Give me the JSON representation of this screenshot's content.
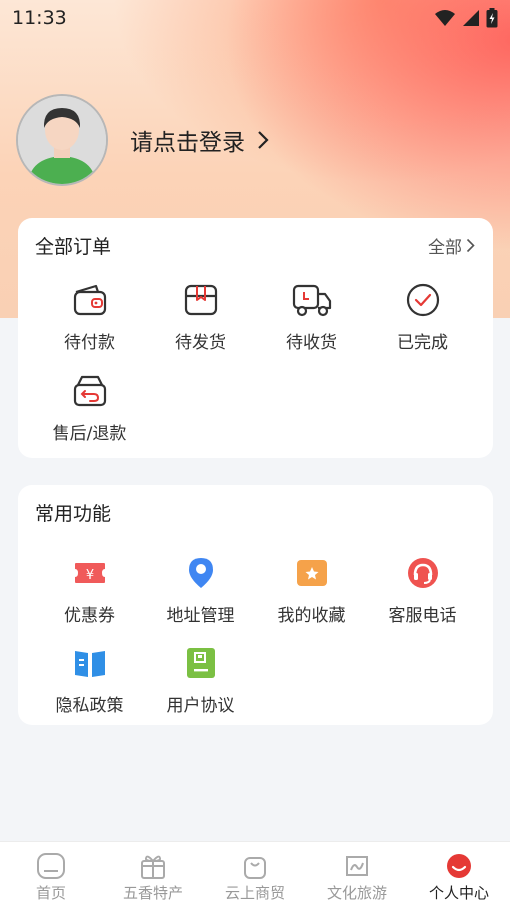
{
  "status": {
    "time": "11:33"
  },
  "profile": {
    "login_text": "请点击登录"
  },
  "orders": {
    "title": "全部订单",
    "more": "全部",
    "items": [
      {
        "label": "待付款",
        "icon": "wallet-icon"
      },
      {
        "label": "待发货",
        "icon": "package-icon"
      },
      {
        "label": "待收货",
        "icon": "truck-icon"
      },
      {
        "label": "已完成",
        "icon": "check-circle-icon"
      },
      {
        "label": "售后/退款",
        "icon": "return-box-icon"
      }
    ]
  },
  "functions": {
    "title": "常用功能",
    "items": [
      {
        "label": "优惠券",
        "icon": "coupon-icon",
        "color": "#f05a5a"
      },
      {
        "label": "地址管理",
        "icon": "location-pin-icon",
        "color": "#3f86f2"
      },
      {
        "label": "我的收藏",
        "icon": "favorite-icon",
        "color": "#f5a24a"
      },
      {
        "label": "客服电话",
        "icon": "headset-icon",
        "color": "#ef5350"
      },
      {
        "label": "隐私政策",
        "icon": "book-icon",
        "color": "#2f8fe6"
      },
      {
        "label": "用户协议",
        "icon": "agreement-icon",
        "color": "#7bc043"
      }
    ]
  },
  "tabbar": {
    "tabs": [
      {
        "label": "首页",
        "icon": "home-icon"
      },
      {
        "label": "五香特产",
        "icon": "gift-icon"
      },
      {
        "label": "云上商贸",
        "icon": "shopping-bag-icon"
      },
      {
        "label": "文化旅游",
        "icon": "culture-travel-icon"
      },
      {
        "label": "个人中心",
        "icon": "profile-smile-icon",
        "active": true
      }
    ],
    "active_color": "#e53935"
  }
}
